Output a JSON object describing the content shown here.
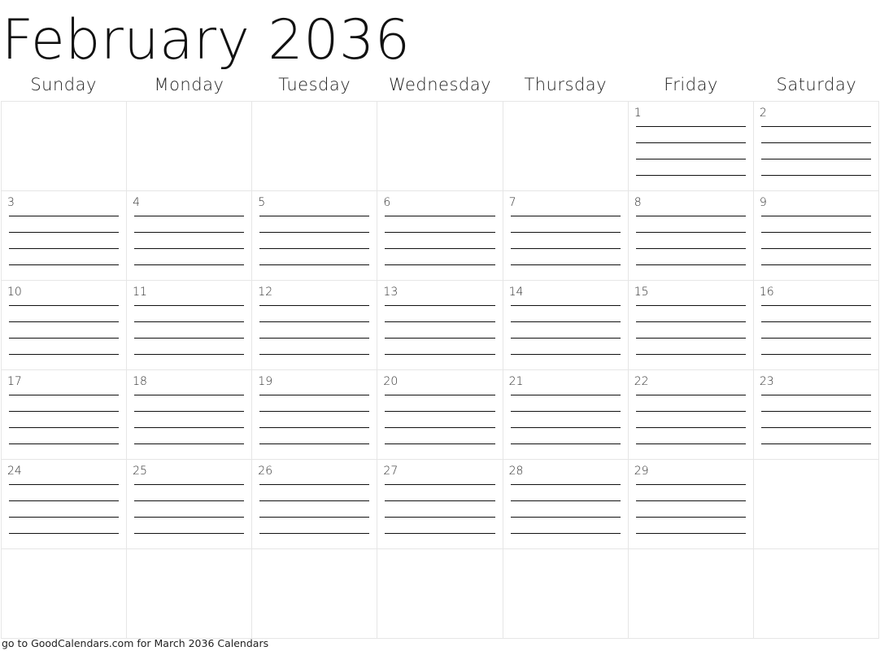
{
  "title": "February 2036",
  "weekdays": [
    "Sunday",
    "Monday",
    "Tuesday",
    "Wednesday",
    "Thursday",
    "Friday",
    "Saturday"
  ],
  "first_weekday_index": 5,
  "days_in_month": 29,
  "total_rows": 6,
  "lines_per_day": 4,
  "footer": "go to GoodCalendars.com for March 2036 Calendars"
}
